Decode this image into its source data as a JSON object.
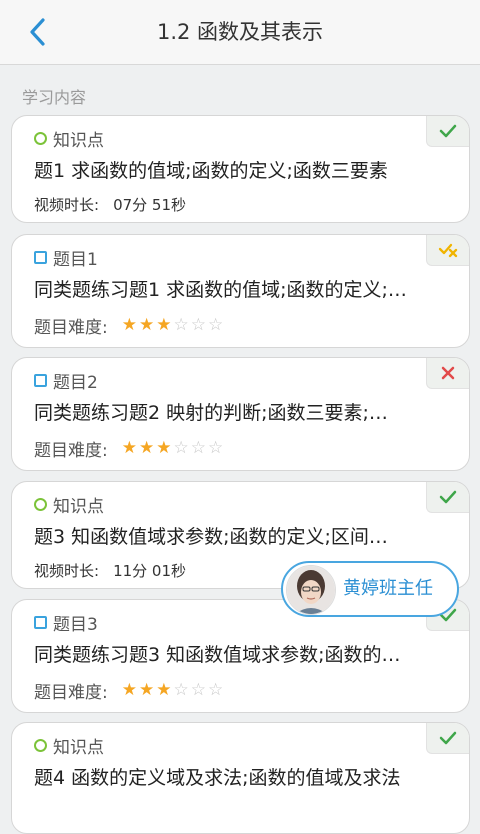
{
  "header": {
    "title": "1.2 函数及其表示"
  },
  "section": {
    "label": "学习内容"
  },
  "cards": [
    {
      "type": "知识点",
      "title": "题1 求函数的值域;函数的定义;函数三要素",
      "meta_label": "视频时长:",
      "meta_value": "07分 51秒",
      "status": "check"
    },
    {
      "type": "题目1",
      "title": "同类题练习题1 求函数的值域;函数的定义;…",
      "meta_label": "题目难度:",
      "difficulty": 3,
      "difficulty_max": 6,
      "status": "partial"
    },
    {
      "type": "题目2",
      "title": "同类题练习题2 映射的判断;函数三要素;…",
      "meta_label": "题目难度:",
      "difficulty": 3,
      "difficulty_max": 6,
      "status": "wrong"
    },
    {
      "type": "知识点",
      "title": "题3 知函数值域求参数;函数的定义;区间…",
      "meta_label": "视频时长:",
      "meta_value": "11分 01秒",
      "status": "check"
    },
    {
      "type": "题目3",
      "title": "同类题练习题3 知函数值域求参数;函数的…",
      "meta_label": "题目难度:",
      "difficulty": 3,
      "difficulty_max": 6,
      "status": "check"
    },
    {
      "type": "知识点",
      "title": "题4 函数的定义域及求法;函数的值域及求法",
      "status": "check"
    }
  ],
  "teacher": {
    "name": "黄婷班主任"
  },
  "colors": {
    "accent": "#49a6e0",
    "green": "#7cc33a",
    "star": "#f5a623",
    "wrong": "#e24a4a"
  }
}
